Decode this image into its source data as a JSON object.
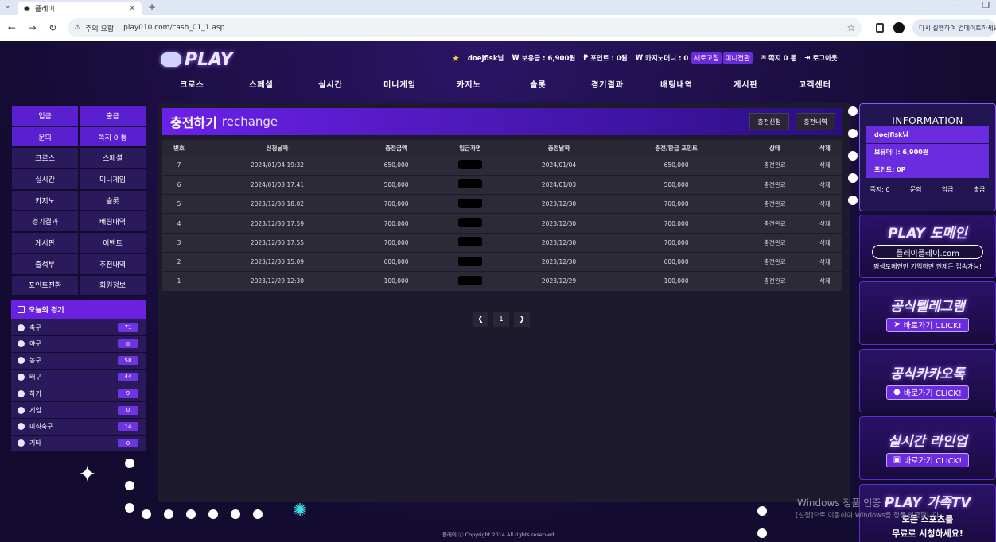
{
  "browser": {
    "tab_title": "플레이",
    "warning": "주의 요함",
    "url": "play010.com/cash_01_1.asp",
    "update_button": "다시 실행하여 업데이트하세요"
  },
  "site": {
    "logo": "PLAY",
    "user": {
      "name": "doejflsk님",
      "balance": "보유금 : 6,900원",
      "point": "포인트 : 0원",
      "casino": "카지노머니 : 0",
      "refresh": "새로고침",
      "mini": "미니전환",
      "message": "쪽지 0 통",
      "logout": "로그아웃"
    },
    "gnb": [
      "크로스",
      "스페셜",
      "실시간",
      "미니게임",
      "카지노",
      "슬롯",
      "경기결과",
      "배팅내역",
      "게시판",
      "고객센터"
    ]
  },
  "left_menu": [
    {
      "label": "입금",
      "style": "purple"
    },
    {
      "label": "출금",
      "style": "purple"
    },
    {
      "label": "문의",
      "style": "purple"
    },
    {
      "label": "쪽지 0 통",
      "style": "purple"
    },
    {
      "label": "크로스",
      "style": "dark"
    },
    {
      "label": "스페셜",
      "style": "dark"
    },
    {
      "label": "실시간",
      "style": "dark"
    },
    {
      "label": "미니게임",
      "style": "dark"
    },
    {
      "label": "카지노",
      "style": "dark"
    },
    {
      "label": "슬롯",
      "style": "dark"
    },
    {
      "label": "경기결과",
      "style": "dark"
    },
    {
      "label": "배팅내역",
      "style": "dark"
    },
    {
      "label": "게시판",
      "style": "dark"
    },
    {
      "label": "이벤트",
      "style": "dark"
    },
    {
      "label": "출석부",
      "style": "dark"
    },
    {
      "label": "추천내역",
      "style": "dark"
    },
    {
      "label": "포인트전환",
      "style": "dark"
    },
    {
      "label": "회원정보",
      "style": "dark"
    }
  ],
  "today_games": {
    "title": "오늘의 경기",
    "items": [
      {
        "name": "축구",
        "count": "71"
      },
      {
        "name": "야구",
        "count": "0"
      },
      {
        "name": "농구",
        "count": "58"
      },
      {
        "name": "배구",
        "count": "44"
      },
      {
        "name": "하키",
        "count": "9"
      },
      {
        "name": "게임",
        "count": "0"
      },
      {
        "name": "미식축구",
        "count": "14"
      },
      {
        "name": "기타",
        "count": "0"
      }
    ]
  },
  "panel": {
    "title": "충전하기",
    "subtitle": "rechange",
    "btn_apply": "충전신청",
    "btn_history": "충전내역",
    "columns": [
      "번호",
      "신청날짜",
      "충전금액",
      "입금자명",
      "충전날짜",
      "충전/환급 포인트",
      "상태",
      "삭제"
    ],
    "rows": [
      [
        "7",
        "2024/01/04 19:32",
        "650,000",
        "",
        "2024/01/04",
        "650,000",
        "충전완료",
        "삭제"
      ],
      [
        "6",
        "2024/01/03 17:41",
        "500,000",
        "",
        "2024/01/03",
        "500,000",
        "충전완료",
        "삭제"
      ],
      [
        "5",
        "2023/12/30 18:02",
        "700,000",
        "",
        "2023/12/30",
        "700,000",
        "충전완료",
        "삭제"
      ],
      [
        "4",
        "2023/12/30 17:59",
        "700,000",
        "",
        "2023/12/30",
        "700,000",
        "충전완료",
        "삭제"
      ],
      [
        "3",
        "2023/12/30 17:55",
        "700,000",
        "",
        "2023/12/30",
        "700,000",
        "충전완료",
        "삭제"
      ],
      [
        "2",
        "2023/12/30 15:09",
        "600,000",
        "",
        "2023/12/30",
        "600,000",
        "충전완료",
        "삭제"
      ],
      [
        "1",
        "2023/12/29 12:30",
        "100,000",
        "",
        "2023/12/29",
        "100,000",
        "충전완료",
        "삭제"
      ]
    ],
    "page": "1"
  },
  "info": {
    "title": "INFORMATION",
    "name": "doejflsk님",
    "money": "보유머니: 6,900원",
    "point": "포인트: 0P",
    "bottom": [
      "쪽지: 0",
      "문의",
      "입금",
      "출금"
    ]
  },
  "banners": {
    "domain": {
      "title": "PLAY 도메인",
      "domain": "플레이플레이.com",
      "note": "평생도메인만 기억하면 언제든 접속가능!"
    },
    "telegram": {
      "title": "공식텔레그램",
      "button": "바로가기 CLICK!"
    },
    "kakao": {
      "title": "공식카카오톡",
      "button": "바로가기 CLICK!"
    },
    "live": {
      "title": "실시간 라인업",
      "button": "바로가기 CLICK!"
    },
    "family": {
      "title": "PLAY 가족TV",
      "line1": "모든 스포츠를",
      "line2": "무료로 시청하세요!"
    }
  },
  "footer": "플레이 ⓒ Copyright 2014 All rights reserved.",
  "watermark": {
    "line1": "Windows 정품 인증",
    "line2": "[설정]으로 이동하여 Windows를 정품 인증합니다."
  }
}
